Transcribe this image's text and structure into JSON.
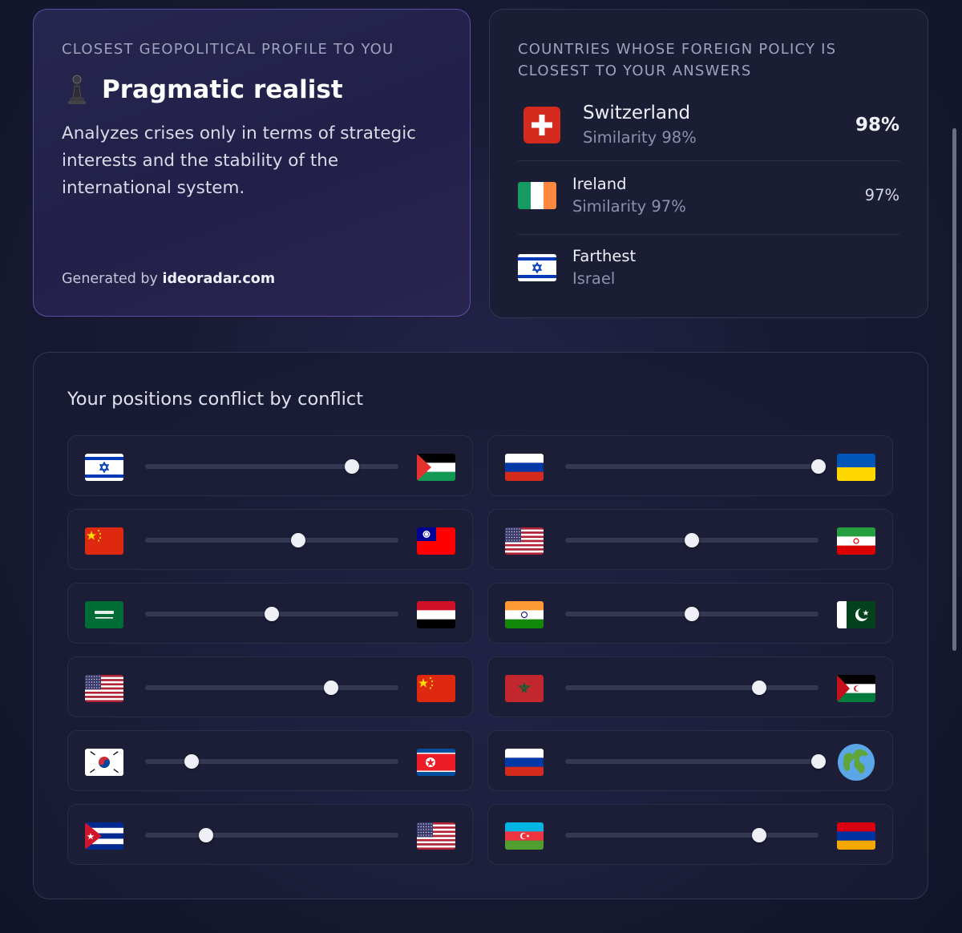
{
  "profile": {
    "eyebrow": "CLOSEST GEOPOLITICAL PROFILE TO YOU",
    "icon": "chess-pawn-icon",
    "title": "Pragmatic realist",
    "description": "Analyzes crises only in terms of strategic interests and the stability of the international system.",
    "generated_prefix": "Generated by",
    "generated_site": "ideoradar.com"
  },
  "countries": {
    "eyebrow": "COUNTRIES WHOSE FOREIGN POLICY IS CLOSEST TO YOUR ANSWERS",
    "top": {
      "flag": "switzerland-flag",
      "name": "Switzerland",
      "sub": "Similarity 98%",
      "pct": "98%"
    },
    "second": {
      "flag": "ireland-flag",
      "name": "Ireland",
      "sub": "Similarity 97%",
      "pct": "97%"
    },
    "farthest": {
      "flag": "israel-flag",
      "label": "Farthest",
      "name": "Israel"
    }
  },
  "conflicts": {
    "title": "Your positions conflict by conflict",
    "items": [
      {
        "left": "israel",
        "right": "palestine",
        "position": 0.815
      },
      {
        "left": "russia",
        "right": "ukraine",
        "position": 1.0
      },
      {
        "left": "china",
        "right": "taiwan",
        "position": 0.605
      },
      {
        "left": "usa",
        "right": "iran",
        "position": 0.5
      },
      {
        "left": "saudi-arabia",
        "right": "yemen",
        "position": 0.5
      },
      {
        "left": "india",
        "right": "pakistan",
        "position": 0.5
      },
      {
        "left": "usa",
        "right": "china",
        "position": 0.735
      },
      {
        "left": "morocco",
        "right": "western-sahara",
        "position": 0.765
      },
      {
        "left": "south-korea",
        "right": "north-korea",
        "position": 0.185
      },
      {
        "left": "russia",
        "right": "world",
        "position": 1.0
      },
      {
        "left": "cuba",
        "right": "usa",
        "position": 0.24
      },
      {
        "left": "azerbaijan",
        "right": "armenia",
        "position": 0.765
      }
    ]
  },
  "colors": {
    "accent_border": "#5a4fa8",
    "card_bg": "#1b1d35",
    "track": "#343953",
    "thumb": "#eef0f6"
  }
}
